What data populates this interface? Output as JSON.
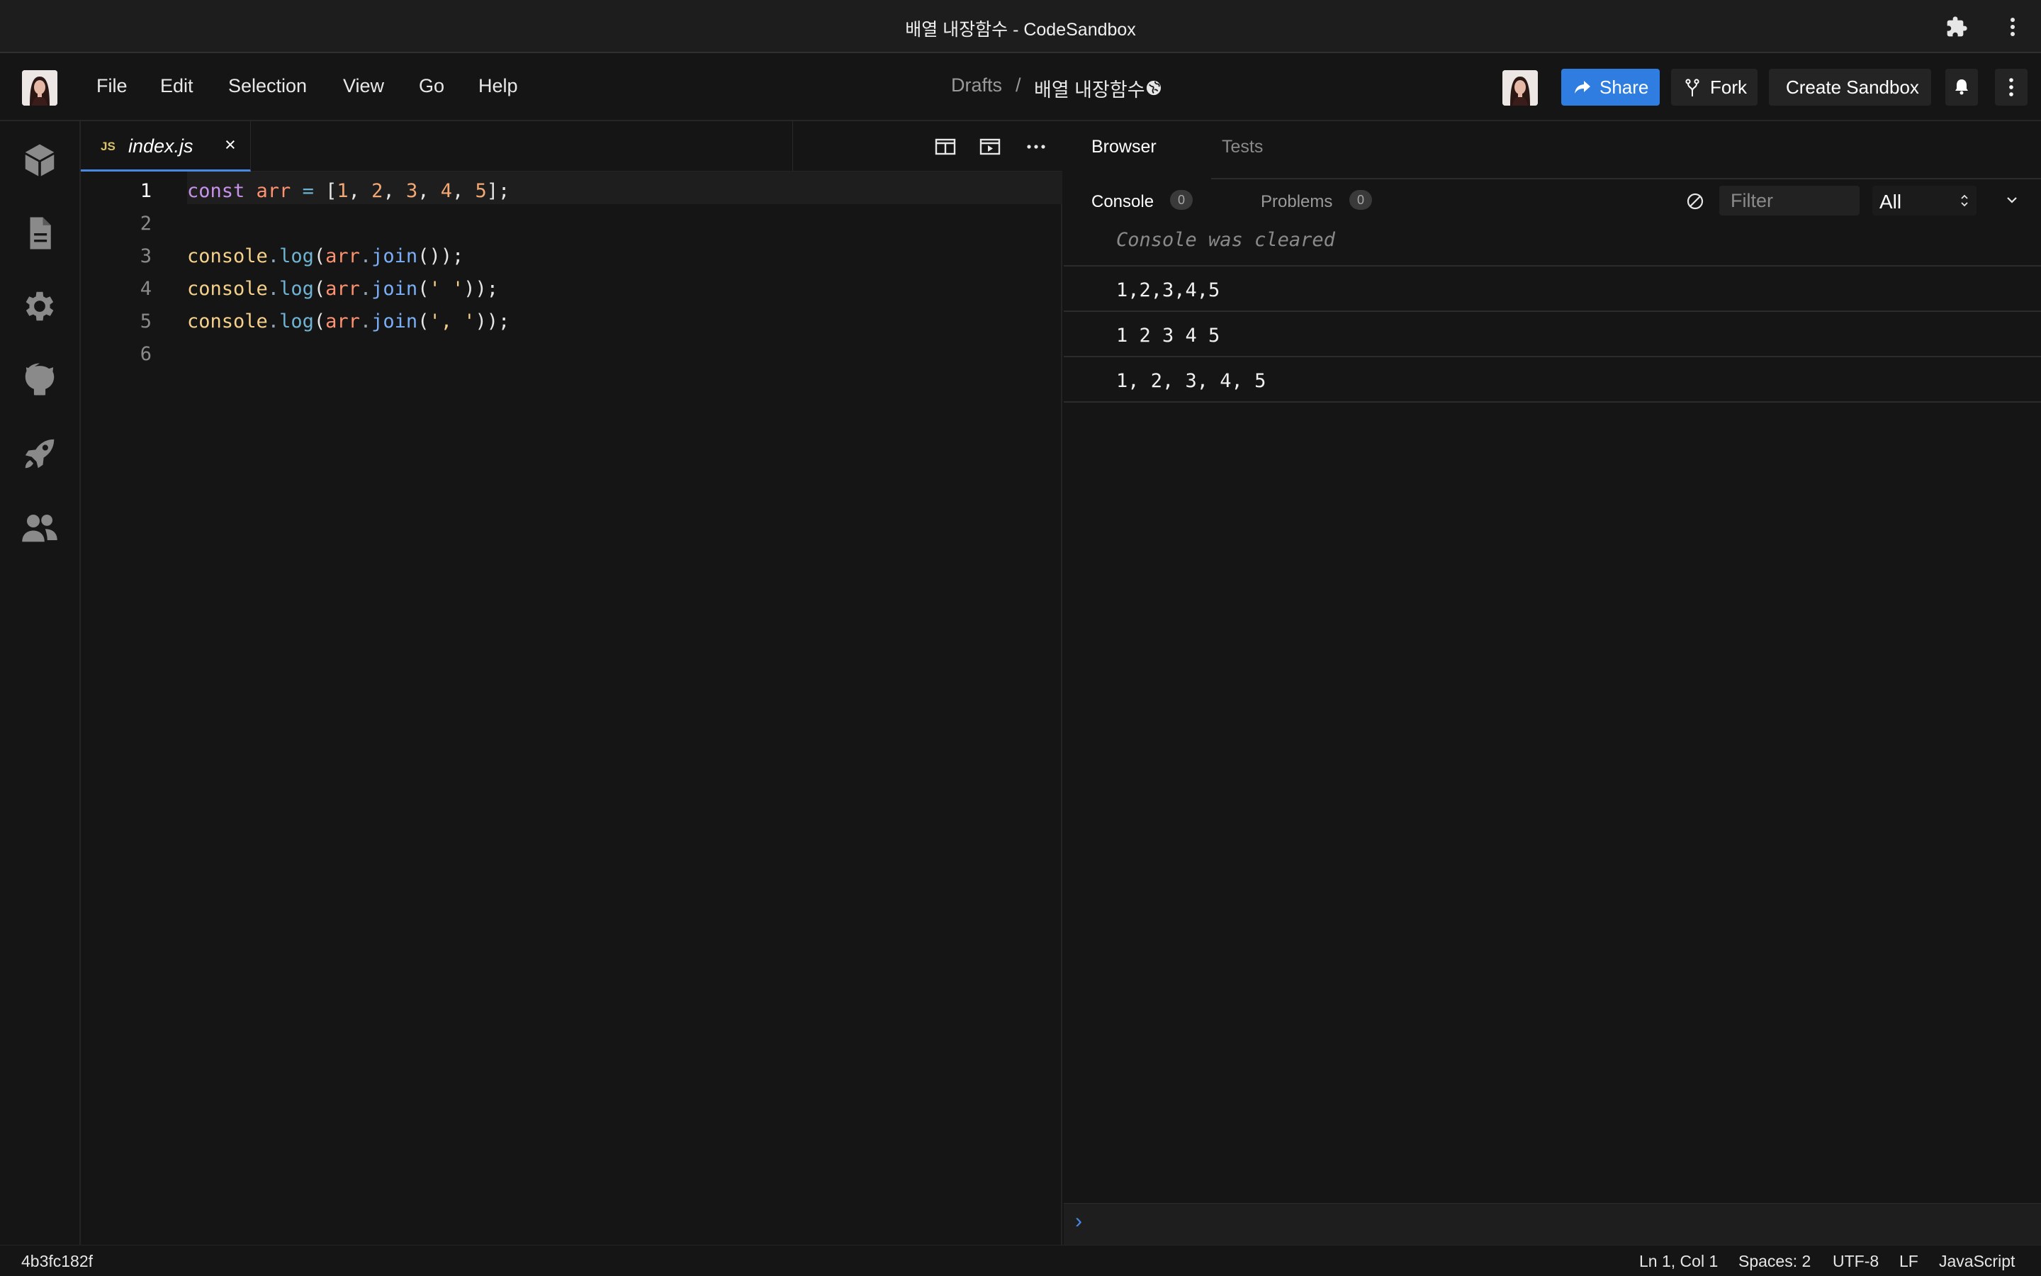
{
  "window": {
    "title": "배열 내장함수 - CodeSandbox"
  },
  "menu": {
    "items": [
      "File",
      "Edit",
      "Selection",
      "View",
      "Go",
      "Help"
    ]
  },
  "breadcrumb": {
    "folder": "Drafts",
    "separator": "/",
    "sandbox_name": "배열 내장함수"
  },
  "header_actions": {
    "share": "Share",
    "fork": "Fork",
    "create": "Create Sandbox"
  },
  "activity_icons": [
    "box-icon",
    "file-icon",
    "gear-icon",
    "github-icon",
    "rocket-icon",
    "users-icon"
  ],
  "editor": {
    "tab": {
      "badge": "JS",
      "filename": "index.js",
      "close": "×"
    },
    "line_numbers": [
      "1",
      "2",
      "3",
      "4",
      "5",
      "6"
    ]
  },
  "preview": {
    "tabs": [
      "Browser",
      "Tests"
    ],
    "console_tab": "Console",
    "console_count": "0",
    "problems_tab": "Problems",
    "problems_count": "0",
    "filter_placeholder": "Filter",
    "level_select": "All",
    "cleared_message": "Console was cleared",
    "output": [
      "1,2,3,4,5",
      "1 2 3 4 5",
      "1, 2, 3, 4, 5"
    ],
    "prompt": "›"
  },
  "status": {
    "hash": "4b3fc182f",
    "position": "Ln 1, Col 1",
    "spaces": "Spaces: 2",
    "encoding": "UTF-8",
    "eol": "LF",
    "language": "JavaScript"
  },
  "colors": {
    "accent": "#2f7de1",
    "tab_underline": "#4a88e5",
    "keyword": "#c792ea",
    "function": "#7aaef6",
    "string": "#f5d18b"
  }
}
